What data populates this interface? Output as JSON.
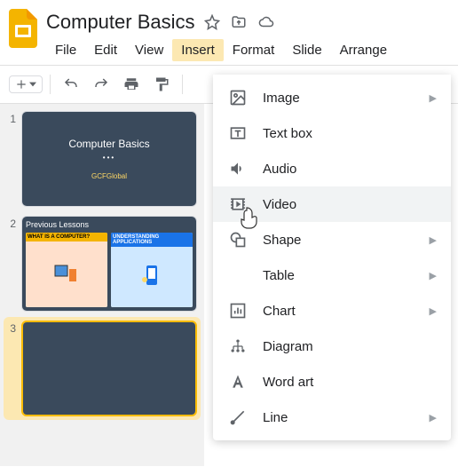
{
  "header": {
    "title": "Computer Basics"
  },
  "menubar": {
    "items": [
      "File",
      "Edit",
      "View",
      "Insert",
      "Format",
      "Slide",
      "Arrange"
    ],
    "active_index": 3
  },
  "slides": [
    {
      "number": "1",
      "title": "Computer Basics",
      "footer": "GCFGlobal"
    },
    {
      "number": "2",
      "header": "Previous Lessons",
      "card1": "WHAT IS A COMPUTER?",
      "card2": "UNDERSTANDING APPLICATIONS"
    },
    {
      "number": "3"
    }
  ],
  "dropdown": {
    "items": [
      {
        "label": "Image",
        "icon": "image",
        "arrow": true
      },
      {
        "label": "Text box",
        "icon": "textbox",
        "arrow": false
      },
      {
        "label": "Audio",
        "icon": "audio",
        "arrow": false
      },
      {
        "label": "Video",
        "icon": "video",
        "arrow": false,
        "hover": true
      },
      {
        "label": "Shape",
        "icon": "shape",
        "arrow": true
      },
      {
        "label": "Table",
        "icon": "table",
        "arrow": true
      },
      {
        "label": "Chart",
        "icon": "chart",
        "arrow": true
      },
      {
        "label": "Diagram",
        "icon": "diagram",
        "arrow": false
      },
      {
        "label": "Word art",
        "icon": "wordart",
        "arrow": false
      },
      {
        "label": "Line",
        "icon": "line",
        "arrow": true
      }
    ]
  }
}
